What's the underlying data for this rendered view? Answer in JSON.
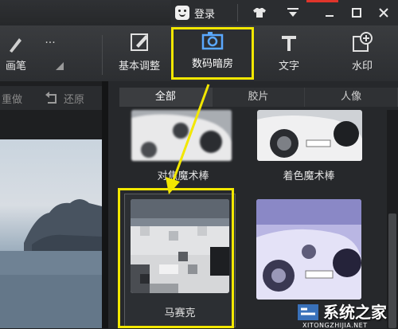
{
  "titlebar": {
    "login_label": "登录"
  },
  "toolbar": {
    "brush_label": "画笔",
    "basic_adjust_label": "基本调整",
    "darkroom_label": "数码暗房",
    "text_label": "文字",
    "watermark_label": "水印",
    "more_label": "..."
  },
  "history": {
    "redo_label": "重做",
    "restore_label": "还原"
  },
  "tabs": [
    {
      "label": "全部",
      "active": true
    },
    {
      "label": "胶片",
      "active": false
    },
    {
      "label": "人像",
      "active": false
    }
  ],
  "effects": {
    "focus_wand": "对焦魔术棒",
    "color_wand": "着色魔术棒",
    "mosaic": "马赛克"
  },
  "site_watermark": {
    "name": "系统之家",
    "url": "XITONGZHIJIA.NET"
  },
  "colors": {
    "highlight": "#f2e700",
    "accent_red": "#e0352b"
  }
}
